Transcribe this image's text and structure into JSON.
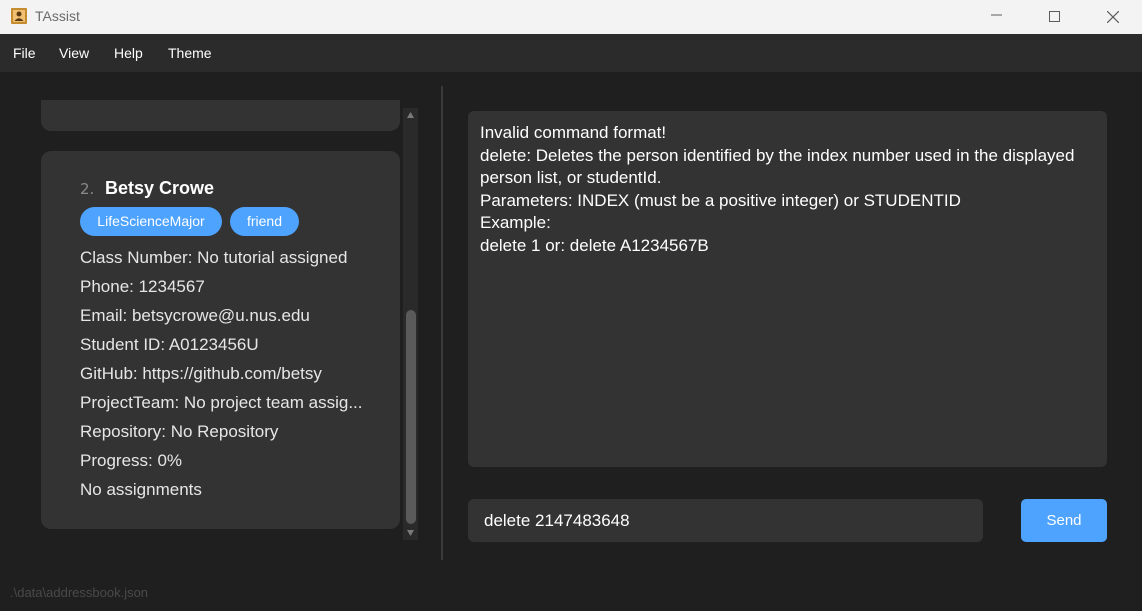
{
  "window": {
    "title": "TAssist",
    "icon": "address-book-icon"
  },
  "menu": {
    "items": [
      "File",
      "View",
      "Help",
      "Theme"
    ]
  },
  "person_card": {
    "index": "2.",
    "name": "Betsy Crowe",
    "tags": [
      "LifeScienceMajor",
      "friend"
    ],
    "fields": [
      "Class Number: No tutorial assigned",
      "Phone: 1234567",
      "Email: betsycrowe@u.nus.edu",
      "Student ID: A0123456U",
      "GitHub: https://github.com/betsy",
      "ProjectTeam: No project team assig...",
      "Repository: No Repository",
      "Progress: 0%",
      "No assignments"
    ]
  },
  "result": {
    "lines": [
      "Invalid command format!",
      "delete: Deletes the person identified by the index number used in the displayed",
      "person list, or studentId.",
      "Parameters: INDEX (must be a positive integer) or STUDENTID",
      "Example:",
      "delete 1 or: delete A1234567B"
    ]
  },
  "command": {
    "value": "delete 2147483648",
    "send_label": "Send"
  },
  "status_bar": {
    "path": ".\\data\\addressbook.json"
  },
  "colors": {
    "background": "#1f1f1f",
    "panel": "#333333",
    "accent": "#4ea3ff",
    "titlebar": "#f3f3f3",
    "menubar": "#2b2b2b"
  }
}
